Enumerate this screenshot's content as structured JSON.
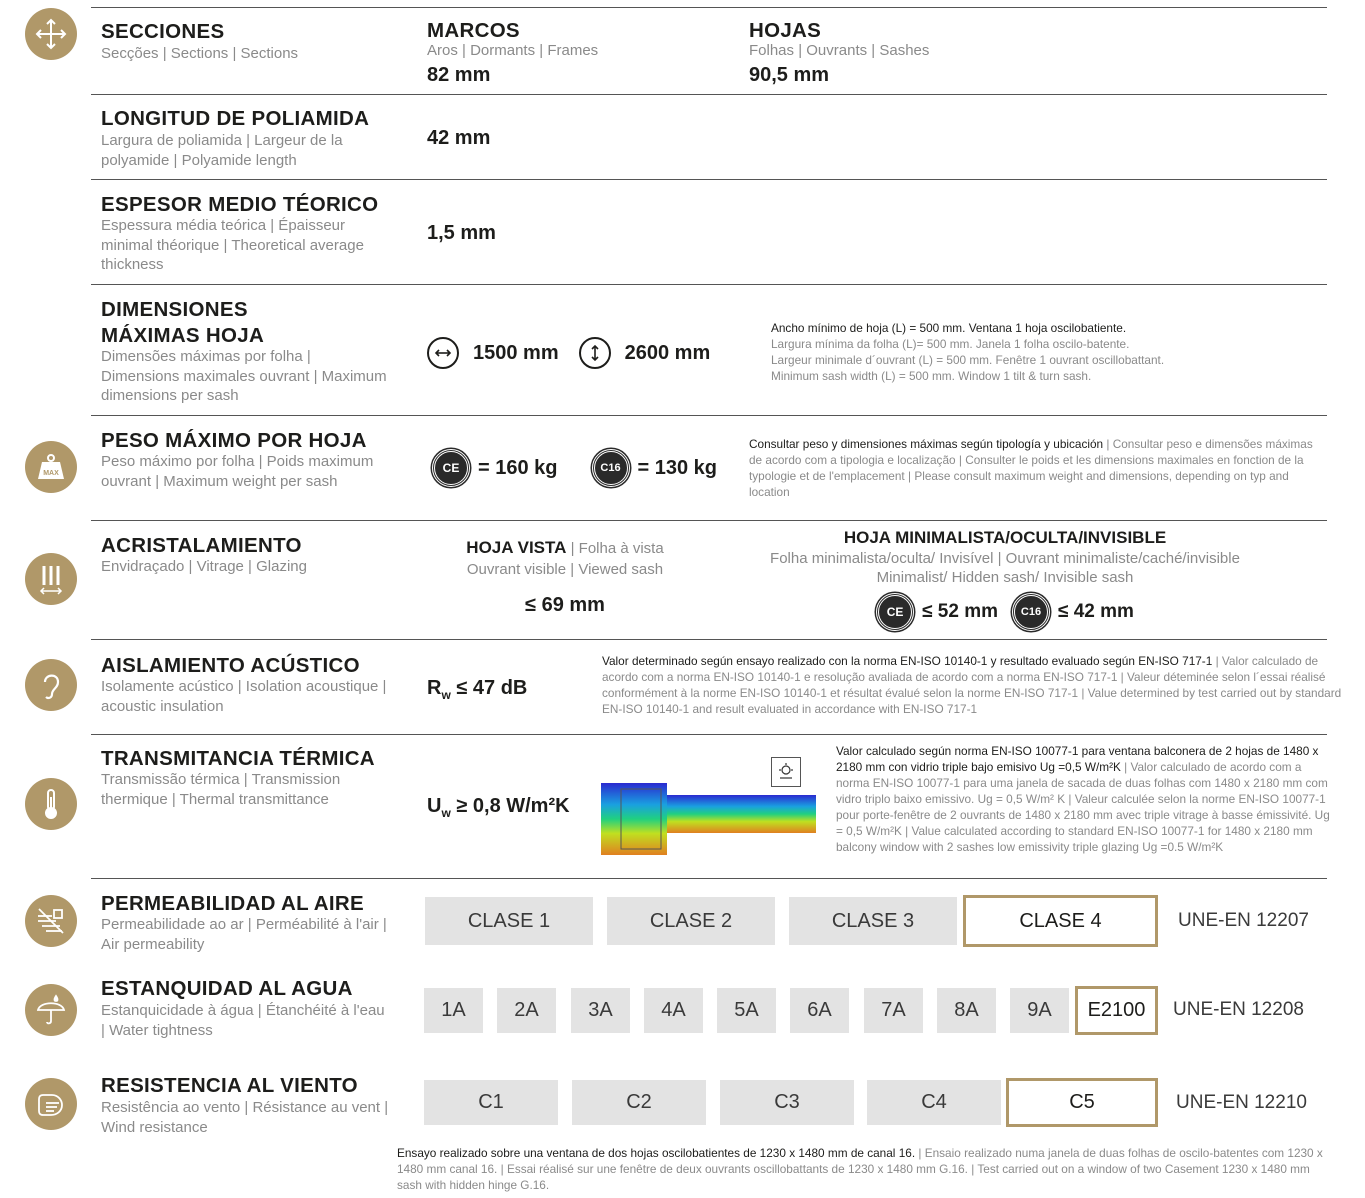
{
  "rows": {
    "secciones": {
      "title": "SECCIONES",
      "sub": "Secções | Sections | Sections",
      "marcos_title": "MARCOS",
      "marcos_sub": "Aros | Dormants | Frames",
      "marcos_value": "82 mm",
      "hojas_title": "HOJAS",
      "hojas_sub": "Folhas | Ouvrants | Sashes",
      "hojas_value": "90,5 mm"
    },
    "poliamida": {
      "title": "LONGITUD DE POLIAMIDA",
      "sub": "Largura de poliamida | Largeur de la polyamide | Polyamide length",
      "value": "42 mm"
    },
    "espesor": {
      "title": "ESPESOR MEDIO TÉORICO",
      "sub": "Espessura média teórica | Épaisseur minimal théorique | Theoretical average thickness",
      "value": "1,5 mm"
    },
    "dimensiones": {
      "title_1": "DIMENSIONES",
      "title_2": "MÁXIMAS HOJA",
      "sub": "Dimensões máximas por folha | Dimensions maximales ouvrant | Maximum dimensions per sash",
      "width_value": "1500 mm",
      "height_value": "2600 mm",
      "note_main": "Ancho mínimo de hoja (L) = 500 mm. Ventana 1 hoja oscilobatiente.",
      "note_pt": "Largura mínima da folha (L)= 500 mm. Janela 1 folha oscilo-batente.",
      "note_fr": "Largeur minimale d´ouvrant (L) = 500 mm. Fenêtre 1 ouvrant oscillobattant.",
      "note_en": "Minimum sash width (L) = 500 mm. Window 1 tilt & turn sash."
    },
    "peso": {
      "title": "PESO MÁXIMO POR HOJA",
      "sub": "Peso máximo por folha | Poids maximum ouvrant | Maximum weight per sash",
      "badge_ce": "CE",
      "badge_c16": "C16",
      "value_ce": "= 160 kg",
      "value_c16": "= 130 kg",
      "note_main": "Consultar peso y dimensiones máximas según tipología y ubicación",
      "note_rest": " | Consultar peso e dimensões máximas de acordo com a tipologia e localização | Consulter le poids et les dimensions maximales en fonction de la typologie et de l'emplacement | Please consult maximum weight and dimensions, depending on typ and location"
    },
    "acristalamiento": {
      "title": "ACRISTALAMIENTO",
      "sub": "Envidraçado | Vitrage | Glazing",
      "vista_title": "HOJA VISTA",
      "vista_sub1": " | Folha à vista",
      "vista_sub2": "Ouvrant visible | Viewed sash",
      "vista_value": "≤ 69 mm",
      "mini_title": "HOJA MINIMALISTA/OCULTA/INVISIBLE",
      "mini_sub1": "Folha minimalista/oculta/ Invisível | Ouvrant minimaliste/caché/invisible",
      "mini_sub2": "Minimalist/ Hidden sash/ Invisible sash",
      "mini_ce": "≤ 52 mm",
      "mini_c16": "≤ 42 mm"
    },
    "acustico": {
      "title": "AISLAMIENTO ACÚSTICO",
      "sub": "Isolamente acústico | Isolation acoustique | acoustic insulation",
      "value_sym": "R",
      "value_sub": "w",
      "value_rest": " ≤ 47 dB",
      "note_main": "Valor determinado según ensayo realizado con la norma EN-ISO 10140-1 y resultado evaluado según EN-ISO 717-1",
      "note_rest": " | Valor calculado de acordo com a norma EN-ISO 10140-1 e resolução avaliada de acordo com a norma EN-ISO 717-1 | Valeur déteminée selon l´essai réalisé conformément à la norme EN-ISO 10140-1 et résultat évalué selon la norme EN-ISO 717-1 | Value determined by test carried out by standard EN-ISO 10140-1 and result evaluated in accordance with EN-ISO 717-1"
    },
    "termica": {
      "title": "TRANSMITANCIA TÉRMICA",
      "sub": "Transmissão térmica | Transmission thermique | Thermal transmittance",
      "value_sym": "U",
      "value_sub": "w",
      "value_rest": " ≥ 0,8 W/m²K",
      "note_main": "Valor calculado según norma EN-ISO 10077-1 para ventana balconera de 2 hojas de 1480 x 2180 mm con vidrio triple bajo emisivo Ug =0,5 W/m²K",
      "note_rest": " | Valor calculado de acordo com a norma EN-ISO 10077-1 para uma janela de sacada de duas folhas com 1480 x 2180 mm com vidro triplo baixo emissivo. Ug = 0,5 W/m² K | Valeur calculée selon la norme EN-ISO 10077-1 pour porte-fenêtre de 2 ouvrants de 1480 x 2180 mm avec triple vitrage à basse émissivité. Ug = 0,5 W/m²K | Value calculated according to standard EN-ISO 10077-1 for 1480 x 2180 mm balcony window with 2 sashes low emissivity triple glazing Ug =0.5 W/m²K"
    },
    "aire": {
      "title": "PERMEABILIDAD AL AIRE",
      "sub": "Permeabilidade ao ar | Perméabilité à l'air | Air permeability",
      "classes": [
        "CLASE 1",
        "CLASE 2",
        "CLASE 3",
        "CLASE 4"
      ],
      "selected": "CLASE 4",
      "standard": "UNE-EN 12207"
    },
    "agua": {
      "title": "ESTANQUIDAD AL AGUA",
      "sub": "Estanquicidade à água | Étanchéité à l'eau | Water tightness",
      "classes": [
        "1A",
        "2A",
        "3A",
        "4A",
        "5A",
        "6A",
        "7A",
        "8A",
        "9A",
        "E2100"
      ],
      "selected": "E2100",
      "standard": "UNE-EN 12208"
    },
    "viento": {
      "title": "RESISTENCIA AL VIENTO",
      "sub": "Resistência ao vento | Résistance au vent | Wind resistance",
      "classes": [
        "C1",
        "C2",
        "C3",
        "C4",
        "C5"
      ],
      "selected": "C5",
      "standard": "UNE-EN 12210"
    }
  },
  "footer": {
    "note_main": "Ensayo realizado sobre una ventana de dos hojas oscilobatientes de 1230 x 1480 mm de canal 16.",
    "note_rest": " | Ensaio realizado numa janela de duas folhas de oscilo-batentes com 1230 x 1480 mm canal 16. | Essai réalisé sur une fenêtre de deux ouvrants oscillobattants de 1230 x 1480 mm G.16. | Test carried out on a window of two Casement 1230 x 1480 mm sash with hidden hinge G.16."
  },
  "icons": [
    "move-arrows-icon",
    "weight-max-icon",
    "glazing-icon",
    "ear-icon",
    "thermometer-icon",
    "air-icon",
    "water-drop-icon",
    "wind-icon"
  ],
  "colors": {
    "accent": "#b09869",
    "box": "#e3e3e3",
    "text": "#1d1d1b",
    "grey": "#8a8a8a"
  }
}
